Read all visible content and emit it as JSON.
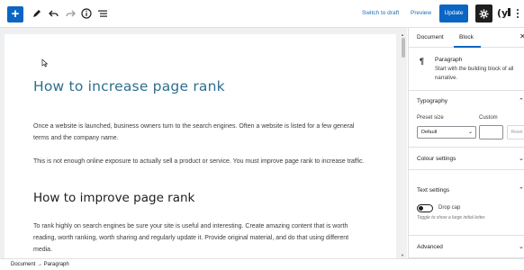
{
  "toolbar": {
    "add_icon": "plus-icon",
    "switch_to_draft": "Switch to draft",
    "preview": "Preview",
    "update": "Update",
    "accent": "#0a66c2"
  },
  "editor": {
    "title": "How to increase page rank",
    "paragraphs": [
      "Once a website is launched, business owners turn to the search engines. Often a website is listed for a few general terms and the company name.",
      "This is not enough online exposure to actually sell a product or service. You must improve page rank to increase traffic."
    ],
    "heading2": "How to improve page rank",
    "paragraph3": "To rank highly on search engines be sure your site is useful and interesting. Create amazing content that is worth reading, worth ranking, worth sharing and regularly update it. Provide original material, and do that using different media."
  },
  "sidebar": {
    "tabs": [
      "Document",
      "Block"
    ],
    "active_tab": "Block",
    "block_name": "Paragraph",
    "block_desc": "Start with the building block of all narrative.",
    "typography": {
      "title": "Typography",
      "preset_label": "Preset size",
      "custom_label": "Custom",
      "preset_value": "Default",
      "reset": "Reset"
    },
    "colour_settings": "Colour settings",
    "text_settings": {
      "title": "Text settings",
      "drop_cap": "Drop cap",
      "help": "Toggle to show a large initial letter."
    },
    "advanced": "Advanced"
  },
  "footer": {
    "breadcrumb": "Document → Paragraph"
  }
}
